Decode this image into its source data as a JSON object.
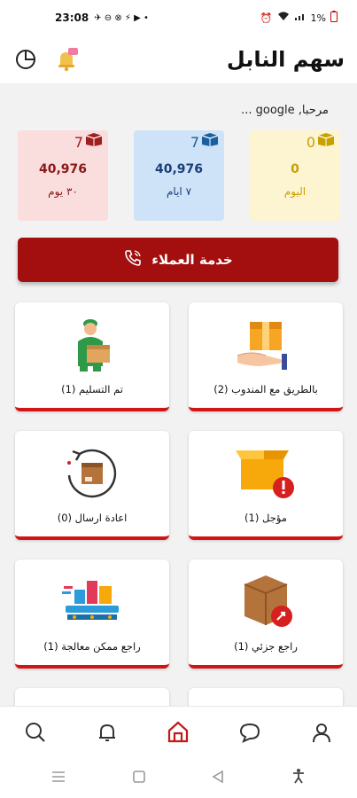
{
  "status": {
    "time": "23:08",
    "icons": "✈ ⊖ ⊗ ⚡ ▶ •",
    "battery": "1%"
  },
  "header": {
    "title": "سهم النابل"
  },
  "greeting": "مرحبا, google ...",
  "stats": [
    {
      "count": "0",
      "amount": "0",
      "label": "اليوم",
      "color": "#c8a000"
    },
    {
      "count": "7",
      "amount": "40,976",
      "label": "٧ ايام",
      "color": "#1a5fa0"
    },
    {
      "count": "7",
      "amount": "40,976",
      "label": "٣٠ يوم",
      "color": "#a02020"
    }
  ],
  "customer_service": {
    "label": "خدمة العملاء"
  },
  "tiles": [
    {
      "label": "بالطريق مع المندوب (2)"
    },
    {
      "label": "تم التسليم (1)"
    },
    {
      "label": "مؤجل (1)"
    },
    {
      "label": "اعادة ارسال (0)"
    },
    {
      "label": "راجع جزئي (1)"
    },
    {
      "label": "راجع ممكن معالجة (1)"
    }
  ],
  "colors": {
    "accent": "#a30f0f",
    "tile_border": "#d11515"
  },
  "nav": [
    "search-icon",
    "bell-icon",
    "home-icon",
    "chat-icon",
    "user-icon"
  ]
}
